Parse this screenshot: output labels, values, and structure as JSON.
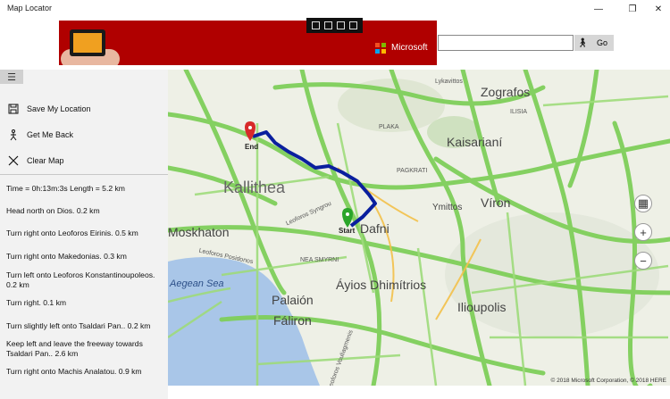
{
  "window": {
    "title": "Map Locator",
    "minimize_glyph": "—",
    "maximize_glyph": "❐",
    "close_glyph": "✕"
  },
  "ad": {
    "brand": "Microsoft",
    "colors": {
      "background": "#b00000"
    }
  },
  "search": {
    "value": "",
    "placeholder": "",
    "icon": "person-walking-icon",
    "go_label": "Go"
  },
  "sidebar": {
    "menu_icon": "hamburger-icon",
    "items": [
      {
        "label": "Save My Location",
        "icon": "save-icon"
      },
      {
        "label": "Get Me Back",
        "icon": "person-walking-icon"
      },
      {
        "label": "Clear Map",
        "icon": "close-icon"
      }
    ],
    "summary": "Time = 0h:13m:3s Length = 5.2 km",
    "steps": [
      "Head north on Dios. 0.2 km",
      "Turn right onto Leoforos Eirinis. 0.5 km",
      "Turn right onto Makedonias. 0.3 km",
      "Turn left onto Leoforos Konstantinoupoleos. 0.2 km",
      "Turn right. 0.1 km",
      "Turn slightly left onto Tsaldari Pan.. 0.2 km",
      "Keep left and leave the freeway towards Tsaldari Pan.. 2.6 km",
      "Turn right onto Machis Analatou. 0.9 km"
    ]
  },
  "map": {
    "labels": {
      "kallithea": "Kallithea",
      "moskhaton": "Moskhaton",
      "dafni": "Dafni",
      "vironas": "Víron",
      "kaisariani": "Kaisarianí",
      "zografos": "Zografos",
      "ymittos": "Ymittos",
      "ayios": "Áyios Dhimítrios",
      "palaion": "Palaión",
      "faliron": "Fáliron",
      "ilioupolis": "Ilioupolis",
      "aegean": "Aegean Sea",
      "plaka": "PLAKA",
      "lykavittos": "Lykavittos",
      "ilisia": "ILISIA",
      "pagkrati": "PAGKRATI",
      "nea_smyrni": "NEA SMYRNI",
      "leoforos_syngrou": "Leoforos Syngrou",
      "leoforos_posidonos": "Leoforos Posidonos",
      "leoforos_vouliagmenis": "Leoforos Vouliagmenis"
    },
    "start_label": "Start",
    "end_label": "End",
    "controls": {
      "layers": "▦",
      "zoom_in": "+",
      "zoom_out": "−"
    },
    "copyright": "© 2018 Microsoft Corporation, © 2018 HERE",
    "colors": {
      "route": "#0a1f9e",
      "road_major": "#7fcf5a",
      "road_minor": "#9edb7b",
      "sea": "#a9c6e8",
      "land": "#eef0e6",
      "pin_end": "#d72a2a",
      "pin_start": "#2aa52a"
    }
  }
}
